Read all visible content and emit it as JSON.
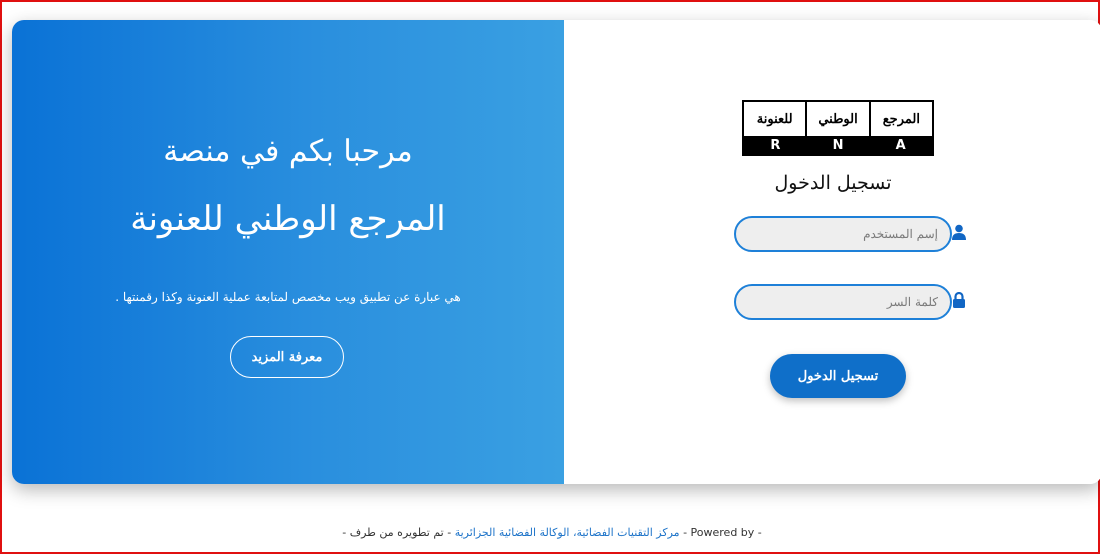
{
  "left": {
    "welcome_line1": "مرحبا بكم في منصة",
    "welcome_line2": "المرجع الوطني للعنونة",
    "description": "هي عبارة عن تطبيق ويب مخصص لمتابعة عملية العنونة وكذا رقمنتها .",
    "more_button": "معرفة المزيد"
  },
  "logo": {
    "word1": "المرجع",
    "word2": "الوطني",
    "word3": "للعنونة",
    "letters": [
      "R",
      "N",
      "A"
    ]
  },
  "login": {
    "title": "تسجيل الدخول",
    "username_placeholder": "إسم المستخدم",
    "password_placeholder": "كلمة السر",
    "submit": "تسجيل الدخول"
  },
  "footer": {
    "developed_by": "- تم تطويره من طرف -",
    "organization": "مركز التقنيات الفضائية، الوكالة الفضائية الجزائرية",
    "powered_by": "- Powered by -"
  },
  "colors": {
    "primary": "#0f6fc9",
    "gradient_start": "#0a72d6",
    "gradient_end": "#3aa0e2",
    "frame": "#e01010"
  }
}
